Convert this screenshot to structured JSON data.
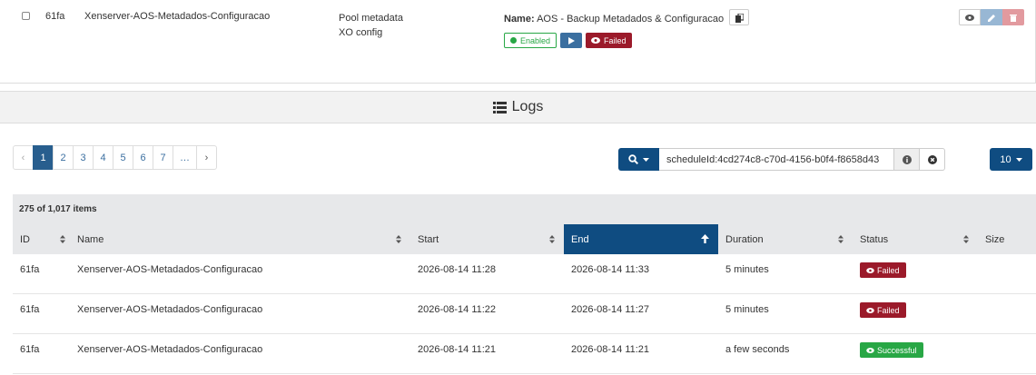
{
  "job": {
    "id": "61fa",
    "name": "Xenserver-AOS-Metadados-Configuracao",
    "modes": [
      "Pool metadata",
      "XO config"
    ],
    "schedule": {
      "name_label": "Name:",
      "name_value": "AOS - Backup Metadados & Configuracao",
      "enabled_label": "Enabled",
      "failed_label": "Failed"
    }
  },
  "logs": {
    "title": "Logs",
    "pagination": [
      "‹",
      "1",
      "2",
      "3",
      "4",
      "5",
      "6",
      "7",
      "…",
      "›"
    ],
    "active_page": "1",
    "filter_value": "scheduleId:4cd274c8-c70d-4156-b0f4-f8658d43",
    "page_size": "10",
    "count_text": "275 of 1,017 items",
    "columns": [
      "ID",
      "Name",
      "Start",
      "End",
      "Duration",
      "Status",
      "Size"
    ],
    "sorted_column": "End",
    "rows": [
      {
        "id": "61fa",
        "name": "Xenserver-AOS-Metadados-Configuracao",
        "start": "2026-08-14 11:28",
        "end": "2026-08-14 11:33",
        "duration": "5 minutes",
        "status": "Failed"
      },
      {
        "id": "61fa",
        "name": "Xenserver-AOS-Metadados-Configuracao",
        "start": "2026-08-14 11:22",
        "end": "2026-08-14 11:27",
        "duration": "5 minutes",
        "status": "Failed"
      },
      {
        "id": "61fa",
        "name": "Xenserver-AOS-Metadados-Configuracao",
        "start": "2026-08-14 11:21",
        "end": "2026-08-14 11:21",
        "duration": "a few seconds",
        "status": "Successful"
      }
    ]
  },
  "colors": {
    "primary": "#0f4c81",
    "failed": "#9b1a2a",
    "success": "#28a745"
  }
}
